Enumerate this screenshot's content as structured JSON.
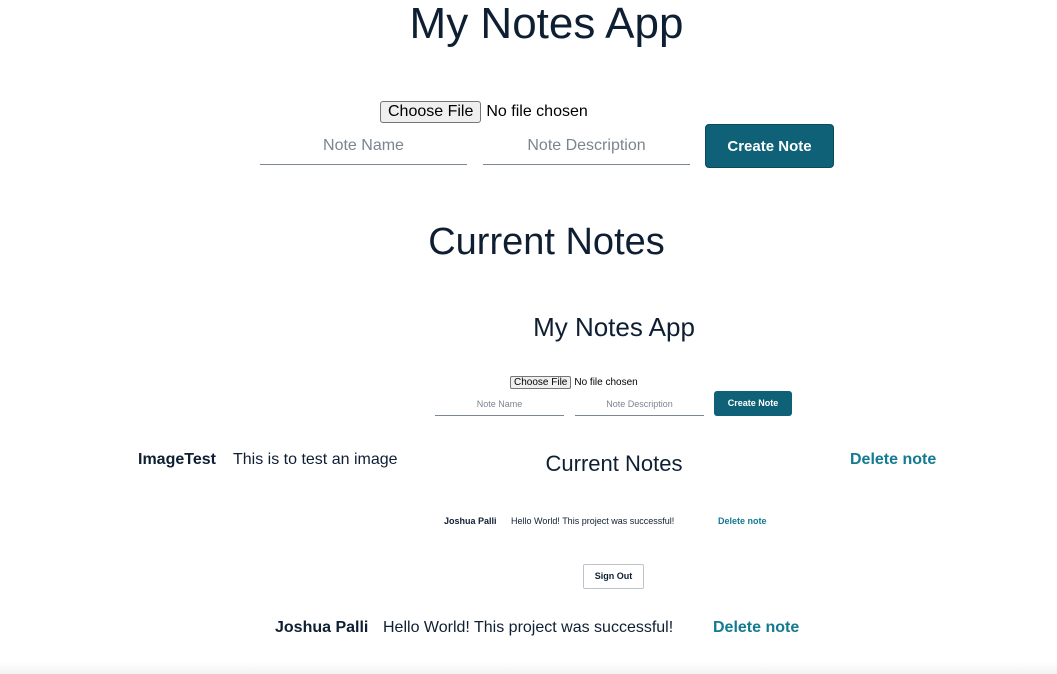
{
  "app": {
    "title": "My Notes App"
  },
  "form": {
    "file_button_label": "Choose File",
    "file_status": "No file chosen",
    "note_name_placeholder": "Note Name",
    "note_description_placeholder": "Note Description",
    "create_button_label": "Create Note"
  },
  "notes_section": {
    "title": "Current Notes"
  },
  "notes": [
    {
      "name": "ImageTest",
      "description": "This is to test an image",
      "delete_label": "Delete note",
      "image": {
        "title": "My Notes App",
        "file_button_label": "Choose File",
        "file_status": "No file chosen",
        "note_name_placeholder": "Note Name",
        "note_description_placeholder": "Note Description",
        "create_button_label": "Create Note",
        "notes_title": "Current Notes",
        "note_name": "Joshua Palli",
        "note_description": "Hello World! This project was successful!",
        "delete_label": "Delete note",
        "sign_out_label": "Sign Out"
      }
    },
    {
      "name": "Joshua Palli",
      "description": "Hello World! This project was successful!",
      "delete_label": "Delete note"
    }
  ],
  "colors": {
    "primary": "#0f6177",
    "link": "#137a92",
    "text": "#0f1f33"
  }
}
